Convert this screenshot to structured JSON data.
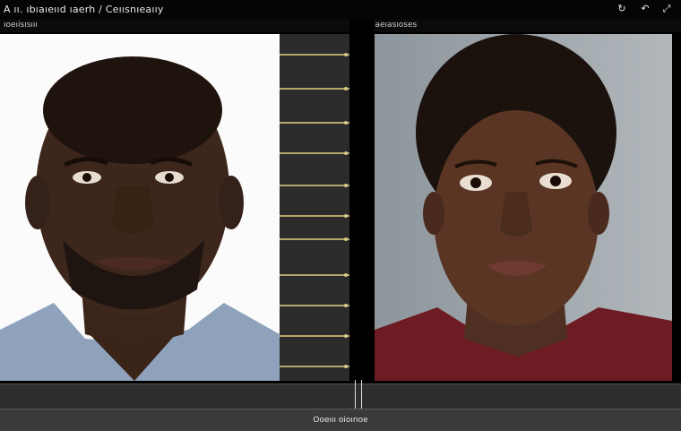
{
  "window": {
    "title": "A ıı. ıbıaıeııd ıaerh / Ceıısnıeaııy"
  },
  "panels": {
    "left_label": "ıoeıisısııı",
    "right_label": "ıaeıasıoses"
  },
  "bottombar": {
    "action_label": "Ooeııı oioınoe"
  },
  "toolbar": {
    "icons": [
      "rotate-icon",
      "undo-icon",
      "expand-icon"
    ]
  },
  "colors": {
    "strip_accent": "#b3a76a",
    "badge": "#c9a227"
  }
}
